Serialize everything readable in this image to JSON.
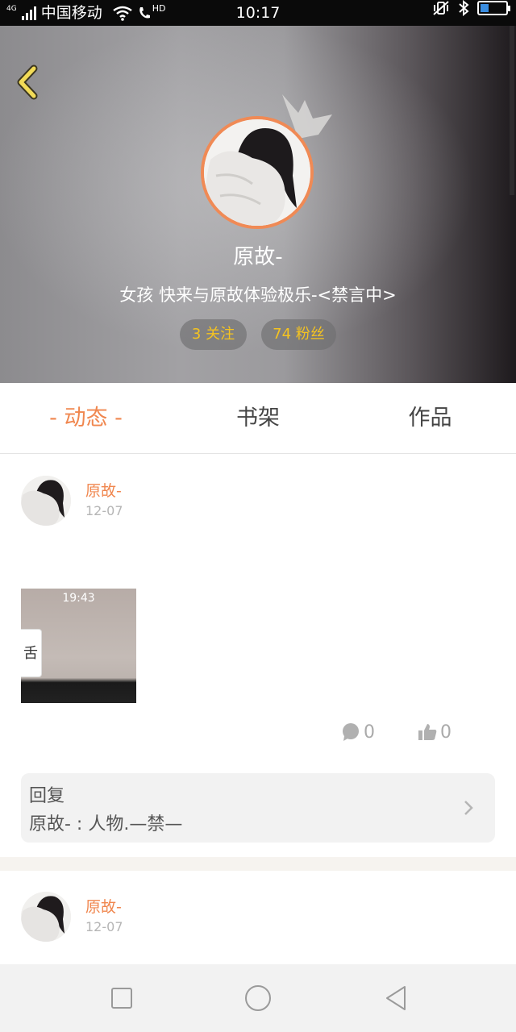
{
  "status_bar": {
    "network_tag": "4G",
    "carrier": "中国移动",
    "hd_label": "HD",
    "time": "10:17"
  },
  "profile": {
    "name": "原故-",
    "bio": "女孩 快来与原故体验极乐-<禁言中>",
    "following": "3 关注",
    "followers": "74 粉丝"
  },
  "tabs": [
    {
      "label": "- 动态 -",
      "active": true
    },
    {
      "label": "书架",
      "active": false
    },
    {
      "label": "作品",
      "active": false
    }
  ],
  "posts": [
    {
      "author": "原故-",
      "date": "12-07",
      "thumbnail_time": "19:43",
      "thumbnail_card_text": "舌",
      "comments": "0",
      "likes": "0",
      "reply_title": "回复",
      "reply_text": "原故- : 人物.—禁—"
    },
    {
      "author": "原故-",
      "date": "12-07"
    }
  ],
  "colors": {
    "accent": "#f0874f",
    "pill_text": "#f5c320",
    "avatar_ring": "#f08a55"
  },
  "icons": {
    "back": "chevron-left-icon",
    "comment": "speech-bubble-icon",
    "like": "thumbs-up-icon",
    "reply_arrow": "chevron-right-icon",
    "nav": [
      "square-icon",
      "circle-icon",
      "triangle-back-icon"
    ]
  }
}
